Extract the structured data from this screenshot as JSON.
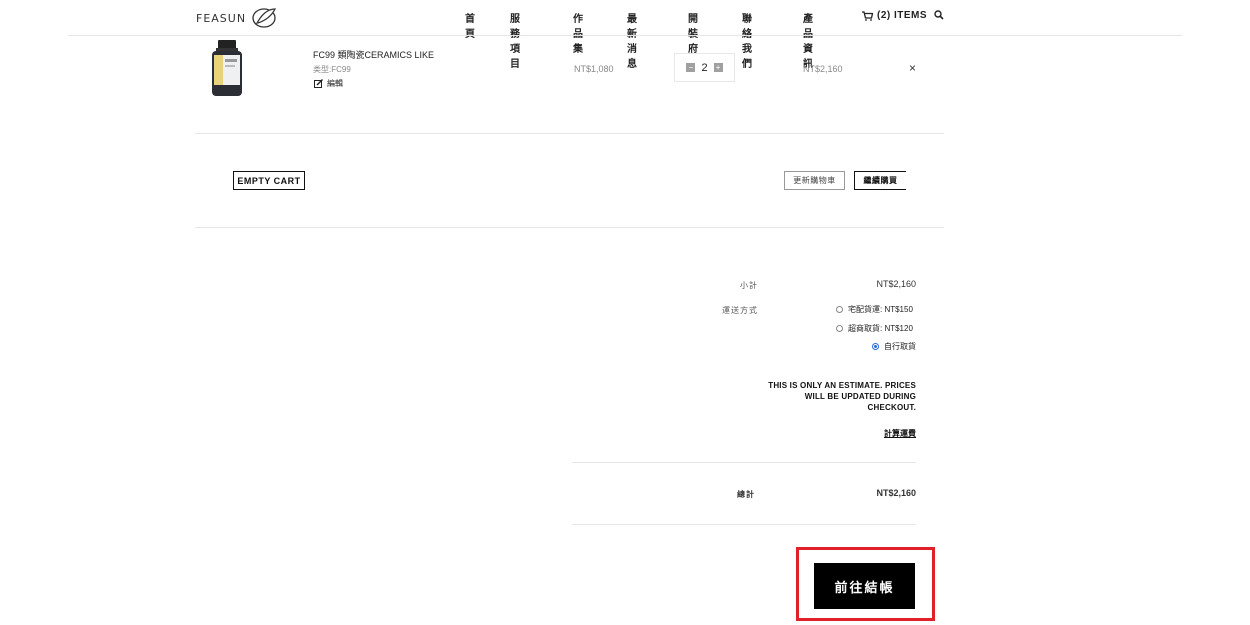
{
  "header": {
    "logo_text": "FEASUN",
    "nav": [
      "首頁",
      "服務項目",
      "作品集",
      "最新消息",
      "開裝府",
      "聯絡我們",
      "產品資訊"
    ],
    "cart_label": "(2) ITEMS"
  },
  "cart_item": {
    "title": "FC99 類陶瓷CERAMICS LIKE",
    "variant": "类型:FC99",
    "edit_label": "編輯",
    "price": "NT$1,080",
    "quantity": "2",
    "qty_minus": "−",
    "qty_plus": "+",
    "line_total": "NT$2,160",
    "remove": "×"
  },
  "actions": {
    "empty_cart": "EMPTY CART",
    "update_cart": "更新購物車",
    "continue_shopping": "繼續購買"
  },
  "summary": {
    "subtotal_label": "小計",
    "subtotal_value": "NT$2,160",
    "shipping_label": "運送方式",
    "shipping_options": [
      {
        "label": "宅配貨運: NT$150",
        "checked": false
      },
      {
        "label": "超商取貨: NT$120",
        "checked": false
      },
      {
        "label": "自行取貨",
        "checked": true
      }
    ],
    "estimate_note": "THIS IS ONLY AN ESTIMATE. PRICES WILL BE UPDATED DURING CHECKOUT.",
    "calculate_link": "計算運費",
    "total_label": "總計",
    "total_value": "NT$2,160",
    "checkout_button": "前往結帳"
  },
  "colors": {
    "accent_radio": "#2a6fd6",
    "highlight_frame": "#e0202a",
    "checkout_bg": "#000000"
  }
}
